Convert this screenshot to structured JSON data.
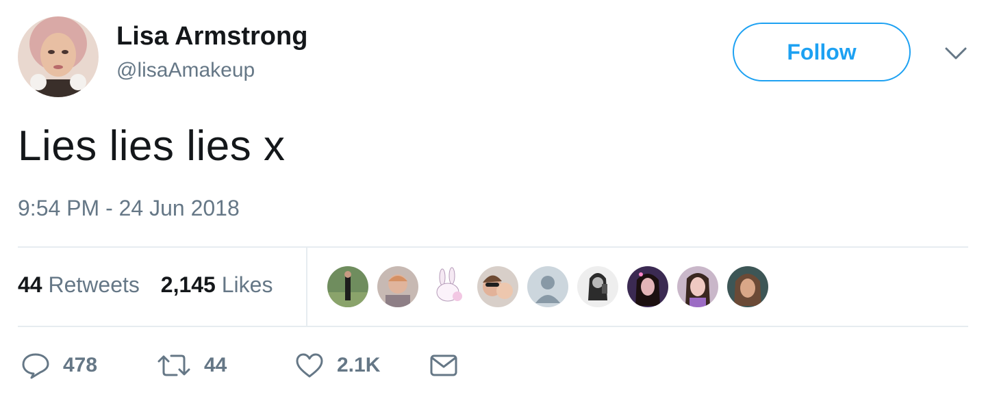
{
  "user": {
    "display_name": "Lisa Armstrong",
    "handle": "@lisaAmakeup"
  },
  "header": {
    "follow_label": "Follow",
    "menu_icon": "chevron-down-icon"
  },
  "tweet": {
    "text": "Lies lies lies x",
    "timestamp": "9:54 PM - 24 Jun 2018"
  },
  "stats": {
    "retweets_count": "44",
    "retweets_label": "Retweets",
    "likes_count": "2,145",
    "likes_label": "Likes"
  },
  "likers": [
    {
      "icon": "user-avatar"
    },
    {
      "icon": "user-avatar"
    },
    {
      "icon": "bunny-avatar"
    },
    {
      "icon": "user-avatar"
    },
    {
      "icon": "default-avatar"
    },
    {
      "icon": "user-avatar"
    },
    {
      "icon": "user-avatar"
    },
    {
      "icon": "user-avatar"
    },
    {
      "icon": "user-avatar"
    }
  ],
  "actions": {
    "reply_count": "478",
    "retweet_count": "44",
    "like_count": "2.1K"
  },
  "colors": {
    "accent": "#1da1f2",
    "text_primary": "#14171a",
    "text_secondary": "#657786",
    "divider": "#e6ecf0"
  }
}
